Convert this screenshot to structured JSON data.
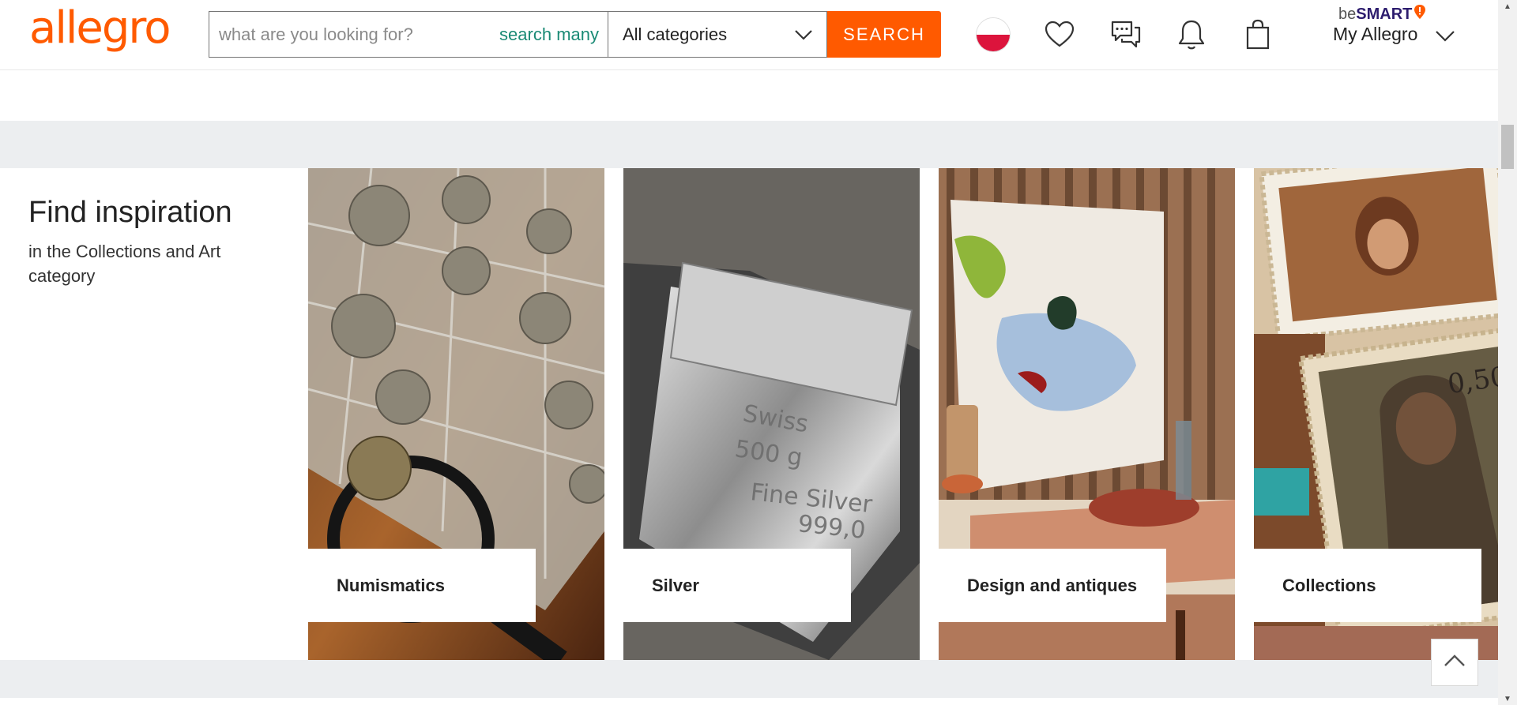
{
  "header": {
    "logo_text": "allegro",
    "search": {
      "placeholder": "what are you looking for?",
      "search_many_label": "search many"
    },
    "category_select": {
      "selected": "All categories"
    },
    "search_button_label": "SEARCH",
    "besmart": {
      "prefix": "be",
      "brand": "SMART"
    },
    "my_allegro_label": "My Allegro",
    "icons": [
      "flag-poland-icon",
      "heart-icon",
      "messages-icon",
      "bell-icon",
      "shopping-bag-icon",
      "chevron-down-icon"
    ]
  },
  "inspiration": {
    "title": "Find inspiration",
    "subtitle": "in the Collections and Art category",
    "tiles": [
      {
        "label": "Numismatics"
      },
      {
        "label": "Silver"
      },
      {
        "label": "Design and antiques"
      },
      {
        "label": "Collections"
      }
    ]
  },
  "colors": {
    "brand": "#ff5a00",
    "search_many": "#1a8a75",
    "band_grey": "#eceef0",
    "besmart_purple": "#2d1d6e"
  }
}
